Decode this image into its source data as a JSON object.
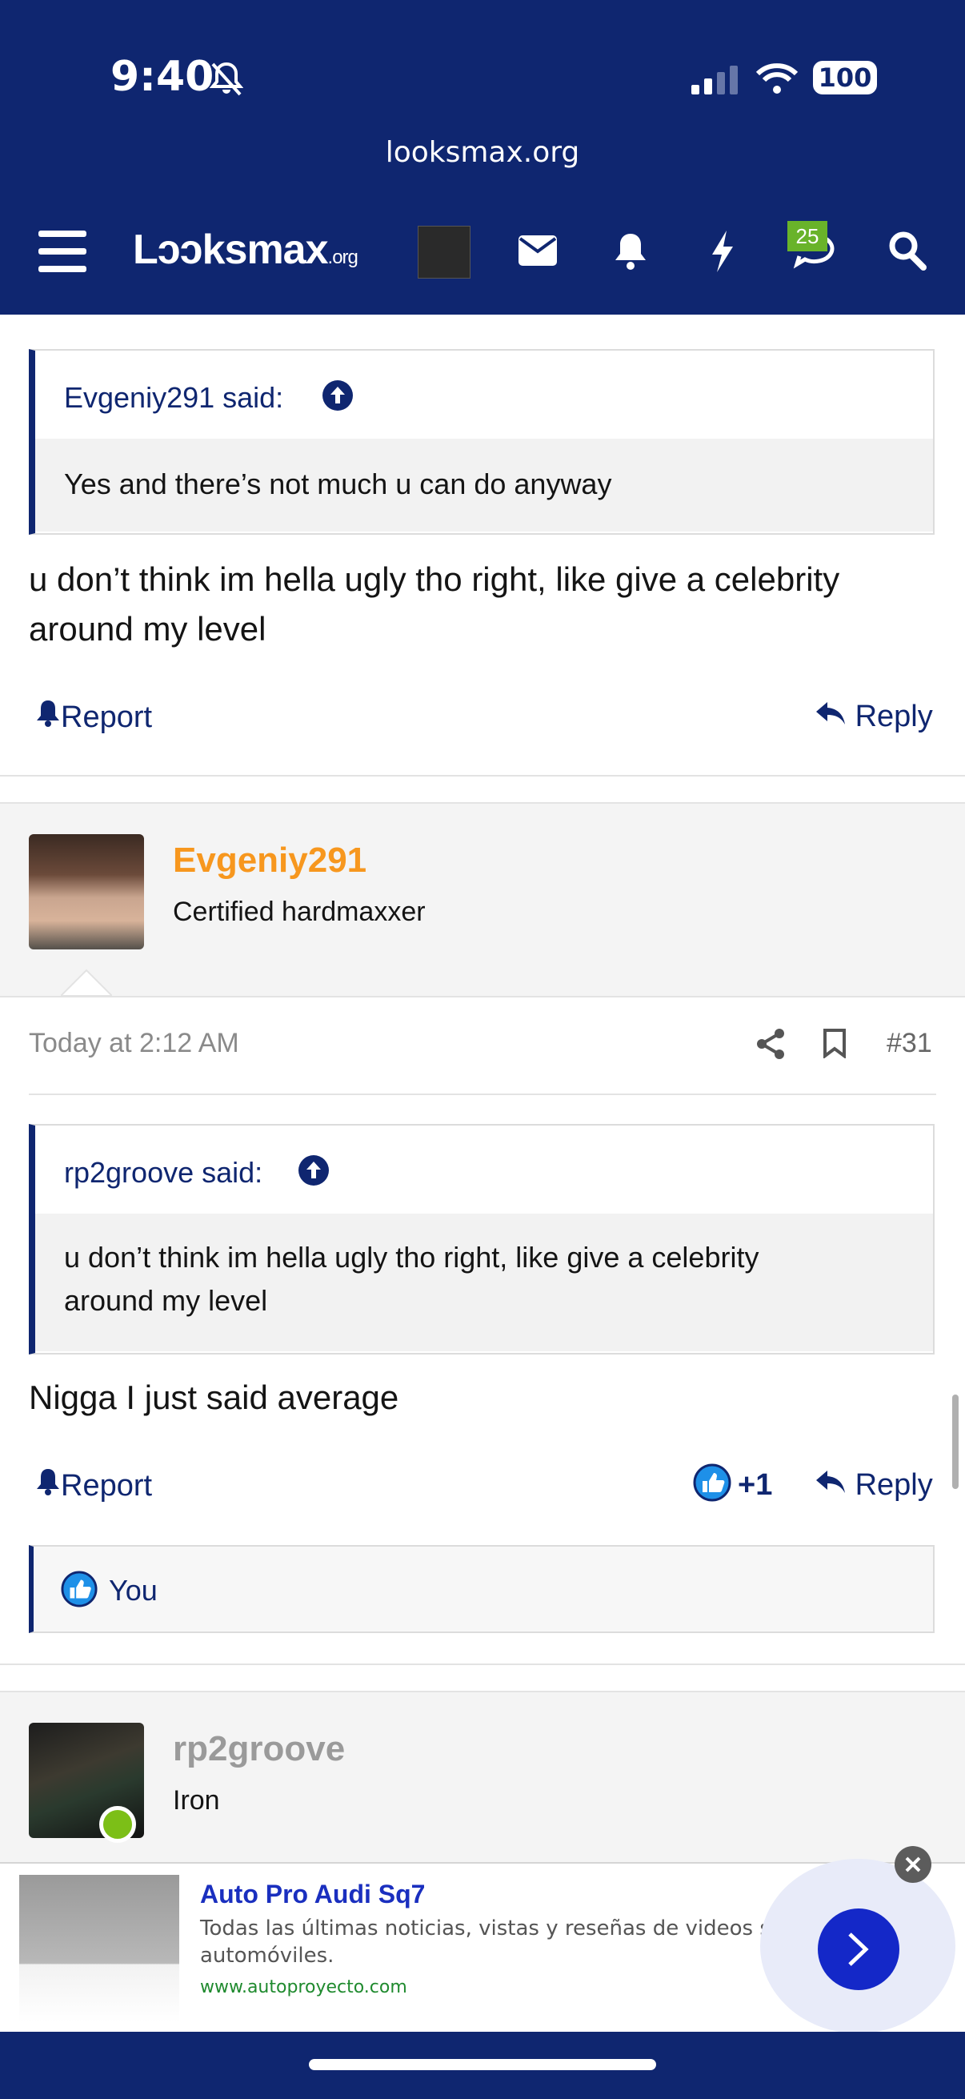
{
  "status": {
    "time": "9:40",
    "battery": "100"
  },
  "browser": {
    "url": "looksmax.org"
  },
  "nav": {
    "logo_main": "Lɔɔksmax",
    "logo_suffix": ".org",
    "notification_count": "25"
  },
  "post1": {
    "quote_author": "Evgeniy291 said:",
    "quote_text": "Yes and there’s not much u can do anyway",
    "body_line1": "u don’t think im hella ugly tho right, like give a celebrity",
    "body_line2": "around my level",
    "report": "Report",
    "reply": "Reply"
  },
  "post2": {
    "username": "Evgeniy291",
    "user_title": "Certified hardmaxxer",
    "timestamp": "Today at 2:12 AM",
    "post_number": "#31",
    "quote_author": "rp2groove said:",
    "quote_line1": "u don’t think im hella ugly tho right, like give a celebrity",
    "quote_line2": "around my level",
    "body": "Nigga I just said average",
    "report": "Report",
    "reaction_count": "+1",
    "reply": "Reply",
    "liked_by": "You"
  },
  "post3": {
    "username": "rp2groove",
    "user_title": "Iron"
  },
  "ad": {
    "title": "Auto Pro Audi Sq7",
    "desc_line1": "Todas las últimas noticias, vistas y reseñas de videos sobre",
    "desc_line2": "automóviles.",
    "domain": "www.autoproyecto.com"
  },
  "colors": {
    "brand": "#0f2670",
    "username_orange": "#f7971e",
    "badge_green": "#69b32a",
    "like_blue": "#1e90e8"
  }
}
